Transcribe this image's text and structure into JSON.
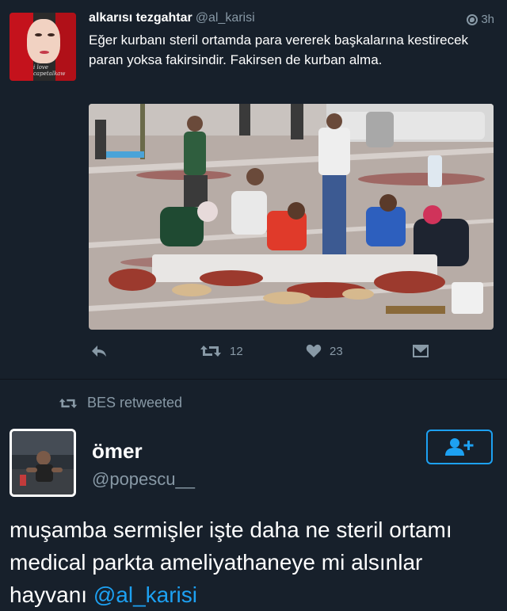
{
  "tweet1": {
    "author_name": "alkarısı tezgahtar",
    "author_handle": "@al_karisi",
    "time": "3h",
    "avatar_signature": "i love capetalkaw",
    "text": "Eğer kurbanı steril ortamda para vererek başkalarına kestirecek paran yoksa fakirsindir. Fakirsen de kurban alma.",
    "retweet_count": "12",
    "like_count": "23"
  },
  "retweet_banner": {
    "label": "BES retweeted"
  },
  "tweet2": {
    "author_name": "ömer",
    "author_handle": "@popescu__",
    "text_main": "muşamba sermişler işte daha ne steril ortamı medical parkta ameliyathaneye mi alsınlar hayvanı ",
    "mention": "@al_karisi"
  },
  "icons": [
    "globe-icon",
    "reply-icon",
    "retweet-icon",
    "heart-icon",
    "direct-message-icon",
    "follow-user-icon"
  ],
  "colors": {
    "background": "#17202b",
    "secondary_text": "#8899a6",
    "accent": "#1da1f2"
  }
}
